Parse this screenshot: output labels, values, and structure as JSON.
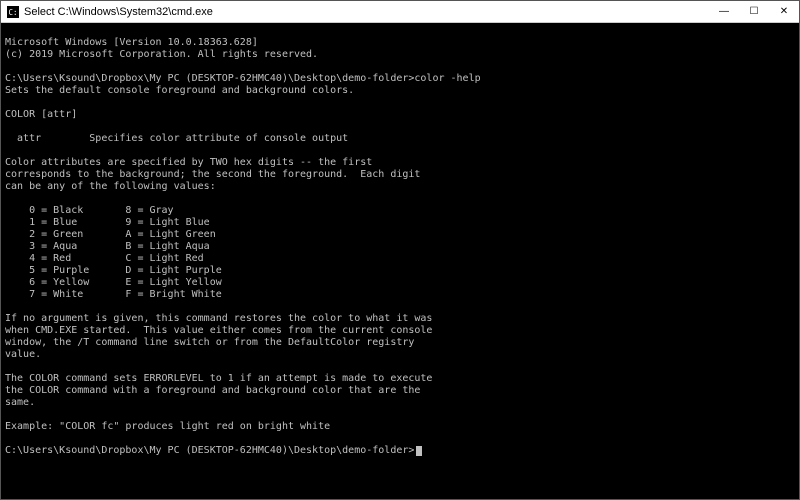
{
  "window": {
    "title": "Select C:\\Windows\\System32\\cmd.exe"
  },
  "controls": {
    "minimize": "—",
    "maximize": "☐",
    "close": "✕"
  },
  "terminal": {
    "header1": "Microsoft Windows [Version 10.0.18363.628]",
    "header2": "(c) 2019 Microsoft Corporation. All rights reserved.",
    "prompt1": "C:\\Users\\Ksound\\Dropbox\\My PC (DESKTOP-62HMC40)\\Desktop\\demo-folder>color -help",
    "desc": "Sets the default console foreground and background colors.",
    "usage": "COLOR [attr]",
    "attrline": "  attr        Specifies color attribute of console output",
    "hex1": "Color attributes are specified by TWO hex digits -- the first",
    "hex2": "corresponds to the background; the second the foreground.  Each digit",
    "hex3": "can be any of the following values:",
    "v0": "    0 = Black       8 = Gray",
    "v1": "    1 = Blue        9 = Light Blue",
    "v2": "    2 = Green       A = Light Green",
    "v3": "    3 = Aqua        B = Light Aqua",
    "v4": "    4 = Red         C = Light Red",
    "v5": "    5 = Purple      D = Light Purple",
    "v6": "    6 = Yellow      E = Light Yellow",
    "v7": "    7 = White       F = Bright White",
    "noarg1": "If no argument is given, this command restores the color to what it was",
    "noarg2": "when CMD.EXE started.  This value either comes from the current console",
    "noarg3": "window, the /T command line switch or from the DefaultColor registry",
    "noarg4": "value.",
    "err1": "The COLOR command sets ERRORLEVEL to 1 if an attempt is made to execute",
    "err2": "the COLOR command with a foreground and background color that are the",
    "err3": "same.",
    "example": "Example: \"COLOR fc\" produces light red on bright white",
    "prompt2": "C:\\Users\\Ksound\\Dropbox\\My PC (DESKTOP-62HMC40)\\Desktop\\demo-folder>"
  }
}
